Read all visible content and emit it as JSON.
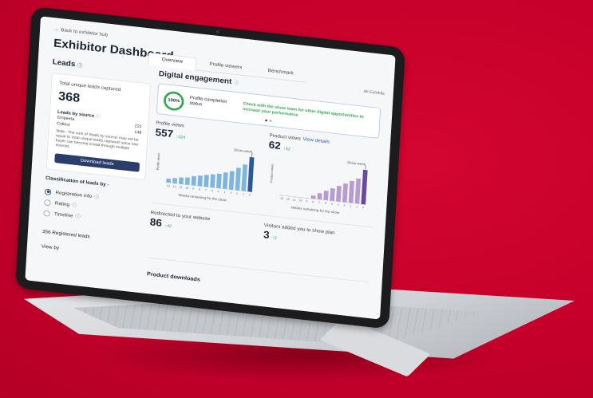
{
  "nav": {
    "back_link": "← Back to exhibitor hub"
  },
  "header": {
    "title": "Exhibitor Dashboard",
    "tabs": [
      {
        "label": "Overview",
        "active": true
      },
      {
        "label": "Profile viewers",
        "active": false
      },
      {
        "label": "Benchmark",
        "active": false
      }
    ],
    "scope": "All Exhibits"
  },
  "leads": {
    "heading": "Leads",
    "total_label": "Total unique leads captured",
    "total_value": "368",
    "by_source_label": "Leads by source",
    "sources": [
      {
        "name": "Empeeta",
        "value": "221"
      },
      {
        "name": "Collect",
        "value": "148"
      }
    ],
    "note": "Note : The sum of 'leads by source' may not be equal to 'total unique leads captured' since one buyer can become a lead through multiple sources",
    "download_label": "Download leads",
    "classification_label": "Classification of leads by -",
    "options": [
      {
        "label": "Registration info",
        "selected": true
      },
      {
        "label": "Rating",
        "selected": false
      },
      {
        "label": "Timeline",
        "selected": false
      }
    ],
    "registered_leads": "356 Registered leads",
    "view_by": "View by"
  },
  "engagement": {
    "heading": "Digital engagement",
    "profile_badge": "100%",
    "profile_label": "Profile completion status",
    "profile_hint": "Check with the show team for other digital opportunities to increase your performance",
    "profile_views": {
      "label": "Profile views",
      "value": "557",
      "delta": "↑324"
    },
    "product_views": {
      "label": "Product views",
      "link": "View details",
      "value": "62",
      "delta": "↑52"
    },
    "redirected": {
      "label": "Redirected to your website",
      "value": "86",
      "delta": "↑42"
    },
    "show_plan": {
      "label": "Visitors added you to show plan",
      "value": "3",
      "delta": "↑2"
    },
    "product_downloads": "Product downloads",
    "show_week_label": "Show week",
    "weeks_caption": "Weeks remaining for the show"
  },
  "colors": {
    "background": "#c8002a",
    "accent": "#2a3d6b",
    "success": "#2ea84f",
    "bar_blue": "#7fb6e0",
    "bar_blue_dark": "#2a5a9c",
    "bar_purple": "#b69cd0",
    "bar_purple_dark": "#6a4a9c"
  },
  "chart_data": [
    {
      "type": "bar",
      "ylabel": "Profile views",
      "xlabel": "Weeks remaining for the show",
      "categories": [
        "13",
        "12",
        "11",
        "10",
        "9",
        "8",
        "7",
        "6",
        "5",
        "4",
        "3",
        "2",
        "1",
        "0"
      ],
      "values": [
        6,
        8,
        10,
        11,
        14,
        16,
        18,
        20,
        22,
        25,
        28,
        34,
        40,
        52
      ],
      "highlight": "Show week"
    },
    {
      "type": "bar",
      "ylabel": "Product views",
      "xlabel": "Weeks remaining for the show",
      "categories": [
        "13",
        "12",
        "11",
        "10",
        "9",
        "8",
        "7",
        "6",
        "5",
        "4",
        "3",
        "2",
        "1",
        "0"
      ],
      "values": [
        0,
        0,
        0,
        0,
        0,
        2,
        4,
        6,
        8,
        10,
        12,
        14,
        16,
        22
      ],
      "highlight": "Show week"
    }
  ]
}
